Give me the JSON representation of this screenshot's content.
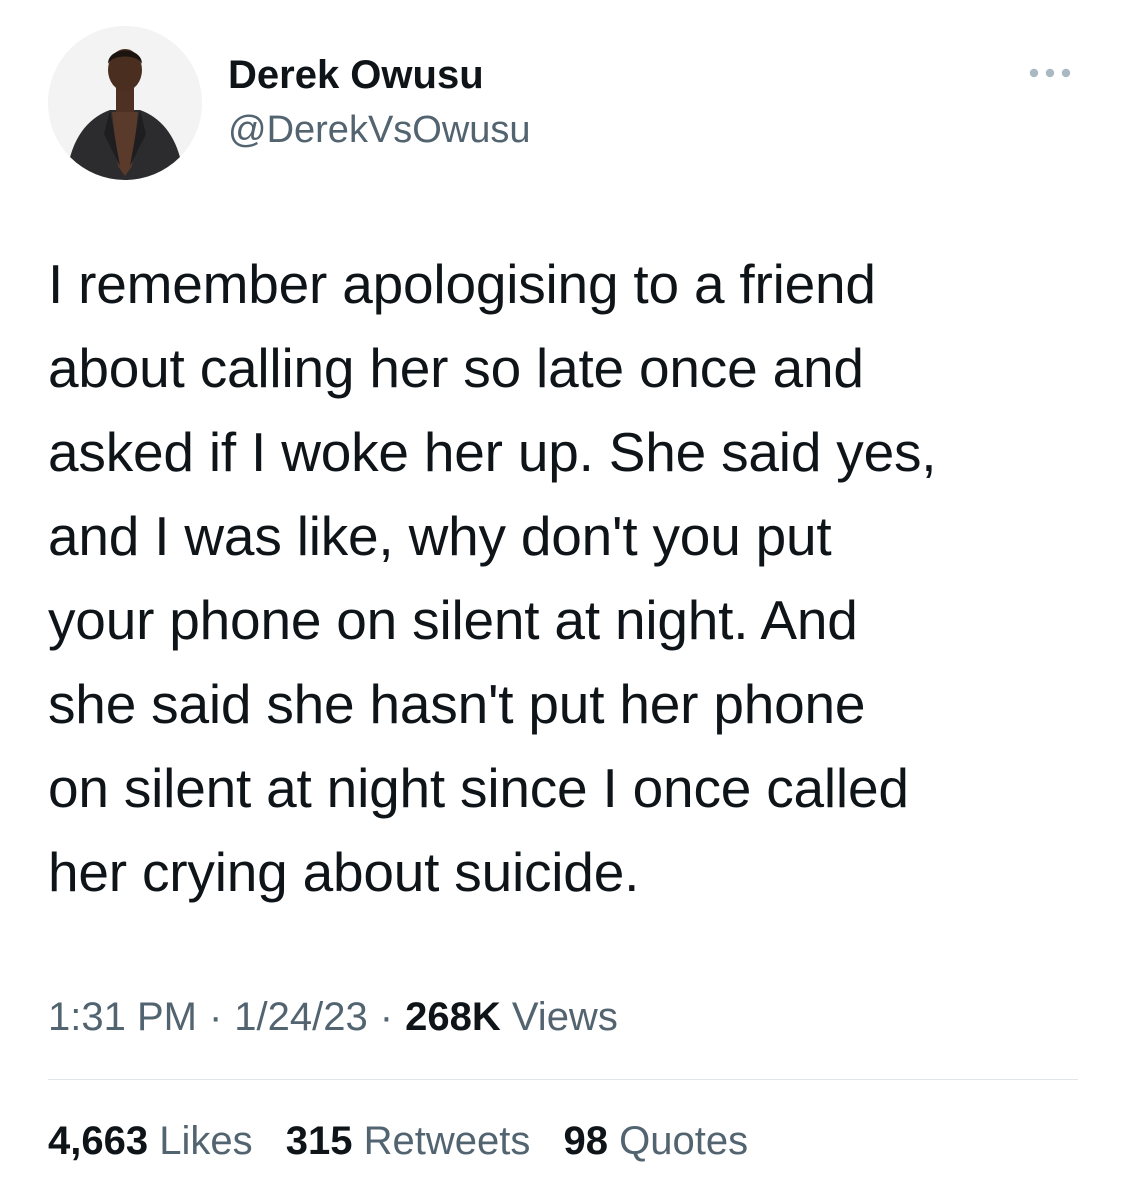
{
  "author": {
    "name": "Derek Owusu",
    "handle": "@DerekVsOwusu"
  },
  "tweet": {
    "text": "I remember apologising to a friend\nabout calling her so late once and\nasked if I woke her up. She said yes,\nand I was like, why don't you put\nyour phone on silent at night. And\nshe said she hasn't put her phone\non silent at night since I once called\nher crying about suicide."
  },
  "meta": {
    "time": "1:31 PM",
    "separator": "·",
    "date": "1/24/23",
    "views_count": "268K",
    "views_label": "Views"
  },
  "stats": {
    "likes_count": "4,663",
    "likes_label": "Likes",
    "retweets_count": "315",
    "retweets_label": "Retweets",
    "quotes_count": "98",
    "quotes_label": "Quotes"
  },
  "icons": {
    "more": "more-dots-icon"
  },
  "colors": {
    "text_primary": "#0f1419",
    "text_secondary": "#536471",
    "divider": "#e1e6ea",
    "more_dots": "#aab8c2"
  }
}
